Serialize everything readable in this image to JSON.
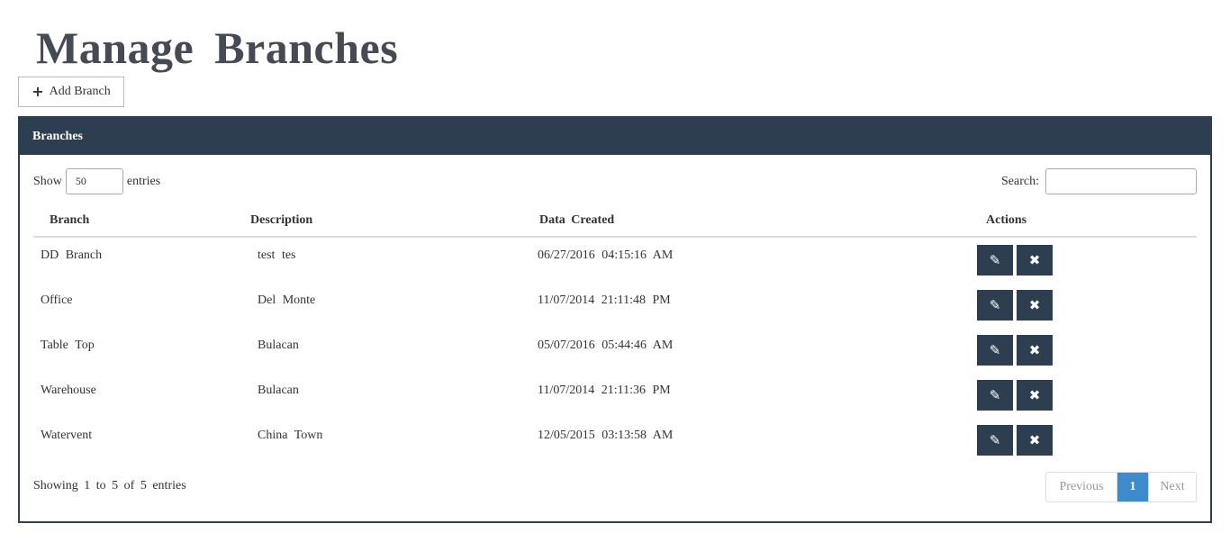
{
  "page": {
    "title": "Manage  Branches",
    "add_button_label": "Add Branch",
    "add_button_icon": "plus-icon"
  },
  "panel": {
    "title": "Branches"
  },
  "table_controls": {
    "show_label": "Show",
    "entries_value": "50",
    "entries_label": "entries",
    "search_label": "Search:",
    "search_value": ""
  },
  "table": {
    "columns": [
      "Branch",
      "Description",
      "Data  Created",
      "Actions"
    ],
    "rows": [
      {
        "branch": "DD Branch",
        "description": "test  tes",
        "created": "06/27/2016   04:15:16   AM"
      },
      {
        "branch": "Office",
        "description": "Del Monte",
        "created": "11/07/2014   21:11:48   PM"
      },
      {
        "branch": "Table  Top",
        "description": "Bulacan",
        "created": "05/07/2016   05:44:46   AM"
      },
      {
        "branch": "Warehouse",
        "description": "Bulacan",
        "created": "11/07/2014   21:11:36   PM"
      },
      {
        "branch": "Watervent",
        "description": "China  Town",
        "created": "12/05/2015   03:13:58   AM"
      }
    ],
    "row_actions": [
      {
        "name": "edit",
        "icon": "pencil-icon"
      },
      {
        "name": "delete",
        "icon": "times-icon"
      }
    ]
  },
  "footer": {
    "info": "Showing  1  to  5  of 5 entries",
    "pagination": {
      "previous": "Previous",
      "current": "1",
      "next": "Next"
    }
  },
  "colors": {
    "panel_header": "#2c3e50",
    "action_button": "#2c3e50",
    "pagination_active": "#3d8bcd",
    "title_text": "#444b55"
  }
}
